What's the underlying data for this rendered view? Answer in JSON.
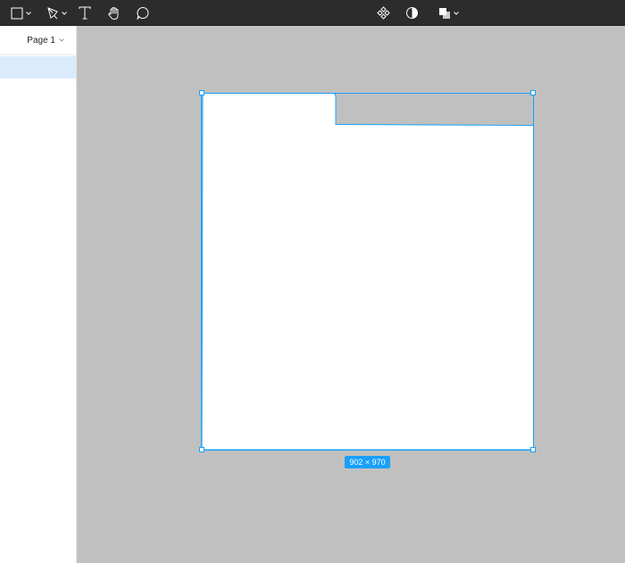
{
  "toolbar": {
    "tools": [
      {
        "name": "frame-tool",
        "icon": "square-icon",
        "has_dropdown": true
      },
      {
        "name": "pen-tool",
        "icon": "pen-icon",
        "has_dropdown": true
      },
      {
        "name": "text-tool",
        "icon": "text-icon",
        "has_dropdown": false
      },
      {
        "name": "hand-tool",
        "icon": "hand-icon",
        "has_dropdown": false
      },
      {
        "name": "comment-tool",
        "icon": "comment-icon",
        "has_dropdown": false
      }
    ],
    "center_tools": [
      {
        "name": "component-button",
        "icon": "component-icon"
      },
      {
        "name": "mask-button",
        "icon": "contrast-icon"
      },
      {
        "name": "boolean-button",
        "icon": "boolean-union-icon",
        "has_dropdown": true
      }
    ]
  },
  "left_panel": {
    "page_label": "Page 1"
  },
  "canvas": {
    "size_badge": "902 × 970"
  },
  "colors": {
    "toolbar_bg": "#2c2c2c",
    "canvas_bg": "#c0c0c0",
    "selection": "#18a0fb",
    "selected_layer": "#daebfc"
  }
}
